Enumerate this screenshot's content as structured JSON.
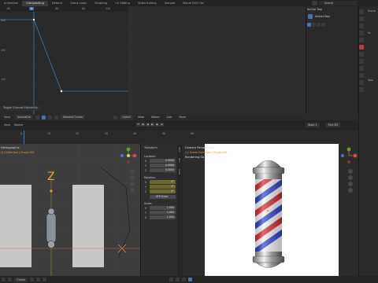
{
  "workspace_tabs": [
    {
      "label": "Animation",
      "active": false
    },
    {
      "label": "Compositing",
      "active": true
    },
    {
      "label": "Default",
      "active": false
    },
    {
      "label": "Game Logic",
      "active": false
    },
    {
      "label": "Scripting",
      "active": false
    },
    {
      "label": "UV Editing",
      "active": false
    },
    {
      "label": "Video Editing",
      "active": false
    },
    {
      "label": "Sample",
      "active": false
    },
    {
      "label": "Movie DOC Hel",
      "active": false
    }
  ],
  "scene_name": "Scene",
  "graph": {
    "ruler_labels": [
      "-80",
      "0",
      "40",
      "80",
      "120"
    ],
    "current_frame_label": "0",
    "y_labels": [
      "200",
      "150",
      "100"
    ],
    "toggle_channel_label": "Toggle Channel Editability"
  },
  "tool_panel": {
    "header": "Active Tool",
    "select_label": "Select Box"
  },
  "header_bar": {
    "view": "View",
    "mode": "Normalize",
    "interp": "Nearest Frame",
    "object_mode": "Object",
    "view2": "View",
    "select": "Select",
    "add": "Add",
    "mode_menu": "Mode"
  },
  "timeline": {
    "view": "View",
    "marker": "Marker",
    "numbers": [
      "0",
      "10",
      "20",
      "30",
      "40",
      "50",
      "60"
    ],
    "start_label": "Start",
    "start_value": "1",
    "end_label": "End",
    "end_value": "83"
  },
  "viewport_left": {
    "title": "Orthographic",
    "subtitle": "(1) Collection | Empty.001"
  },
  "transform": {
    "title": "Transform",
    "location_label": "Location:",
    "location": [
      {
        "axis": "X",
        "value": "0.0000"
      },
      {
        "axis": "Y",
        "value": "0.0000"
      },
      {
        "axis": "Z",
        "value": "0.0000"
      }
    ],
    "rotation_label": "Rotation:",
    "rotation": [
      {
        "axis": "X",
        "value": "0°"
      },
      {
        "axis": "Y",
        "value": "0°"
      },
      {
        "axis": "Z",
        "value": "0°"
      }
    ],
    "rotation_mode": "XYZ Euler",
    "scale_label": "Scale:",
    "scale": [
      {
        "axis": "X",
        "value": "1.000"
      },
      {
        "axis": "Y",
        "value": "1.000"
      },
      {
        "axis": "Z",
        "value": "1.000"
      }
    ]
  },
  "viewport_right": {
    "title": "Camera Perspective",
    "subtitle": "(1) Scene Collection | Empty.001",
    "status": "Rendering Sa"
  },
  "side_tabs": [
    "Item",
    "Tool",
    "View"
  ],
  "footer": {
    "global_label": "Global"
  },
  "colors": {
    "accent": "#4772b3",
    "active_tab": "#3b3b3b",
    "curve": "#3d7ab8",
    "pole_red": "#d3232b",
    "pole_blue": "#2c3fc7",
    "pole_chrome": "#c9c9c9"
  },
  "icons": {
    "gizmo": "navigation-gizmo-icon",
    "camera": "camera-icon",
    "hand": "hand-icon",
    "zoom": "zoom-icon"
  }
}
